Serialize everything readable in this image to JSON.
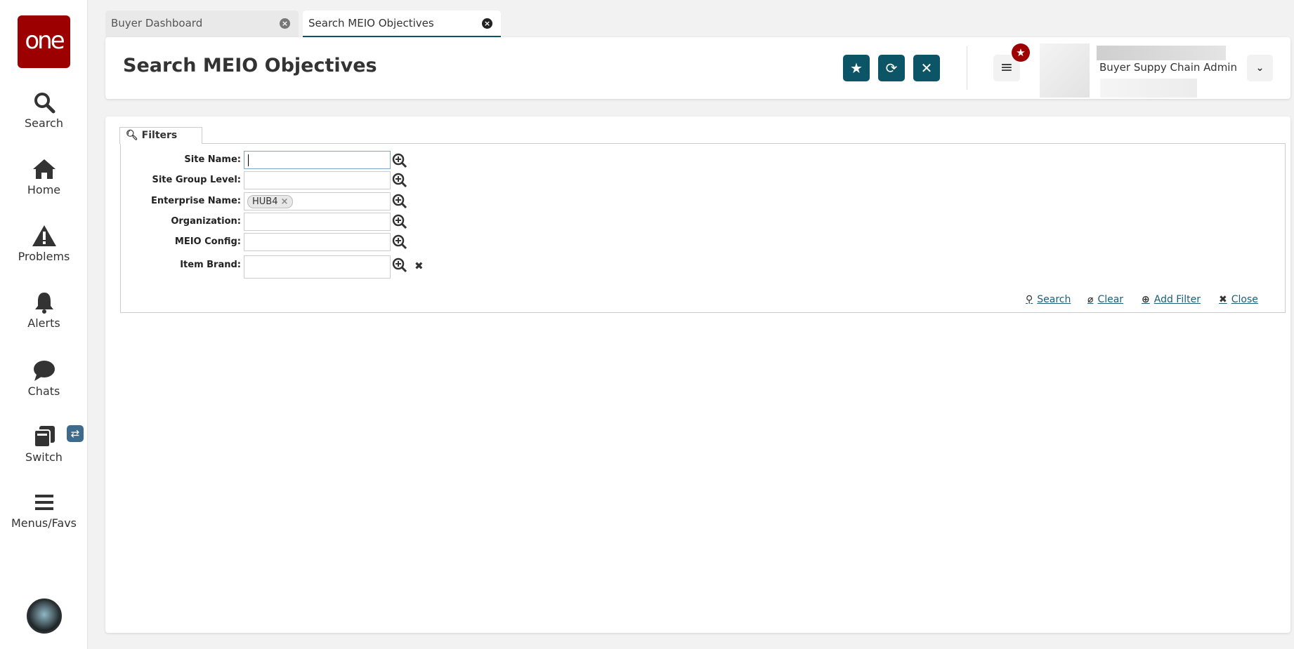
{
  "sidebar": {
    "logo": "one",
    "items": [
      {
        "label": "Search",
        "icon": "search-icon"
      },
      {
        "label": "Home",
        "icon": "home-icon"
      },
      {
        "label": "Problems",
        "icon": "warning-icon"
      },
      {
        "label": "Alerts",
        "icon": "bell-icon"
      },
      {
        "label": "Chats",
        "icon": "chat-icon"
      },
      {
        "label": "Switch",
        "icon": "switch-icon"
      },
      {
        "label": "Menus/Favs",
        "icon": "menu-icon"
      }
    ]
  },
  "tabs": [
    {
      "label": "Buyer Dashboard",
      "active": false
    },
    {
      "label": "Search MEIO Objectives",
      "active": true
    }
  ],
  "header": {
    "title": "Search MEIO Objectives",
    "user_role": "Buyer Suppy Chain Admin"
  },
  "colors": {
    "accent": "#0b5567",
    "brand": "#9c0000",
    "link": "#1a5e7a"
  },
  "filters": {
    "tab_label": "Filters",
    "fields": [
      {
        "label": "Site Name:",
        "value": ""
      },
      {
        "label": "Site Group Level:",
        "value": ""
      },
      {
        "label": "Enterprise Name:",
        "chips": [
          "HUB4"
        ]
      },
      {
        "label": "Organization:",
        "value": ""
      },
      {
        "label": "MEIO Config:",
        "value": ""
      },
      {
        "label": "Item Brand:",
        "value": ""
      }
    ],
    "actions": {
      "search": "Search",
      "clear": "Clear",
      "add_filter": "Add Filter",
      "close": "Close"
    }
  }
}
